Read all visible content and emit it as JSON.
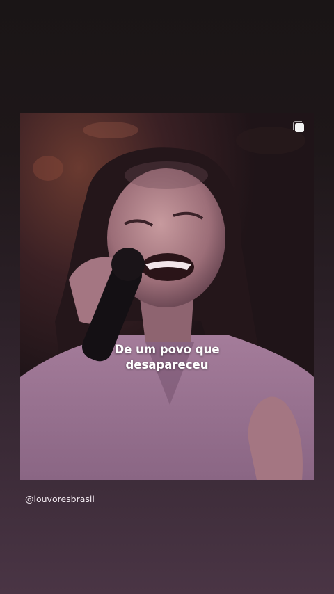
{
  "story": {
    "caption_lines": [
      "De um povo que",
      "desapareceu"
    ],
    "username": "@louvoresbrasil",
    "media_icon": "multiple-images-icon",
    "media_description": "Woman singing into a microphone with eyes closed, wearing a lilac shirt"
  },
  "colors": {
    "background_top": "#1a1516",
    "background_bottom": "#4a3545",
    "shirt": "#b48aa8",
    "caption_text": "#ffffff"
  }
}
